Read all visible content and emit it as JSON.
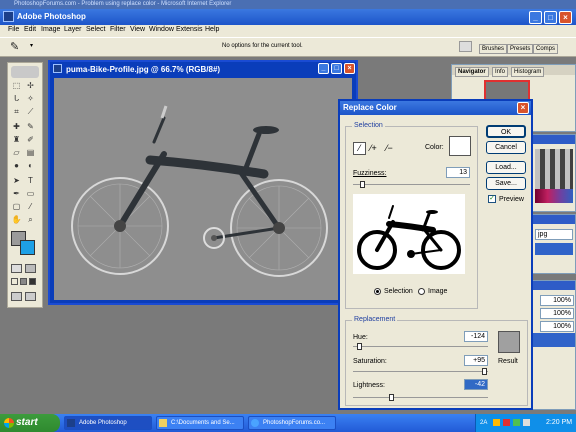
{
  "browser_strip": {
    "text": "PhotoshopForums.com - Problem using replace color - Microsoft Internet Explorer"
  },
  "app": {
    "title": "Adobe Photoshop"
  },
  "menu": [
    "File",
    "Edit",
    "Image",
    "Layer",
    "Select",
    "Filter",
    "View",
    "Window",
    "Extensis",
    "Help"
  ],
  "options_bar": {
    "hint": "No options for the current tool."
  },
  "palette_well": {
    "tabs": [
      "Brushes",
      "Presets",
      "Comps"
    ]
  },
  "document": {
    "title": "puma-Bike-Profile.jpg @ 66.7% (RGB/8#)"
  },
  "navigator": {
    "tabs": [
      "Navigator",
      "Info",
      "Histogram"
    ]
  },
  "right_panels": {
    "field_jpg": "jpg",
    "pct1": "100%",
    "pct2": "100%",
    "pct3": "100%"
  },
  "dialog": {
    "title": "Replace Color",
    "selection_legend": "Selection",
    "color_label": "Color:",
    "fuzziness_label": "Fuzziness:",
    "fuzziness_value": "13",
    "fuzziness_level": 0.06,
    "radio_selection": "Selection",
    "radio_image": "Image",
    "replacement_legend": "Replacement",
    "hue_label": "Hue:",
    "hue_value": "-124",
    "saturation_label": "Saturation:",
    "saturation_value": "+95",
    "lightness_label": "Lightness:",
    "lightness_value": "-42",
    "result_label": "Result",
    "result_color": "#a0a0a0",
    "ok": "OK",
    "cancel": "Cancel",
    "load": "Load...",
    "save": "Save...",
    "preview_label": "Preview",
    "preview_checked": true
  },
  "taskbar": {
    "start": "start",
    "tasks": [
      "Adobe Photoshop",
      "C:\\Documents and Se...",
      "PhotoshopForums.co..."
    ],
    "clock": "2:20 PM",
    "tray_label": "2A"
  }
}
